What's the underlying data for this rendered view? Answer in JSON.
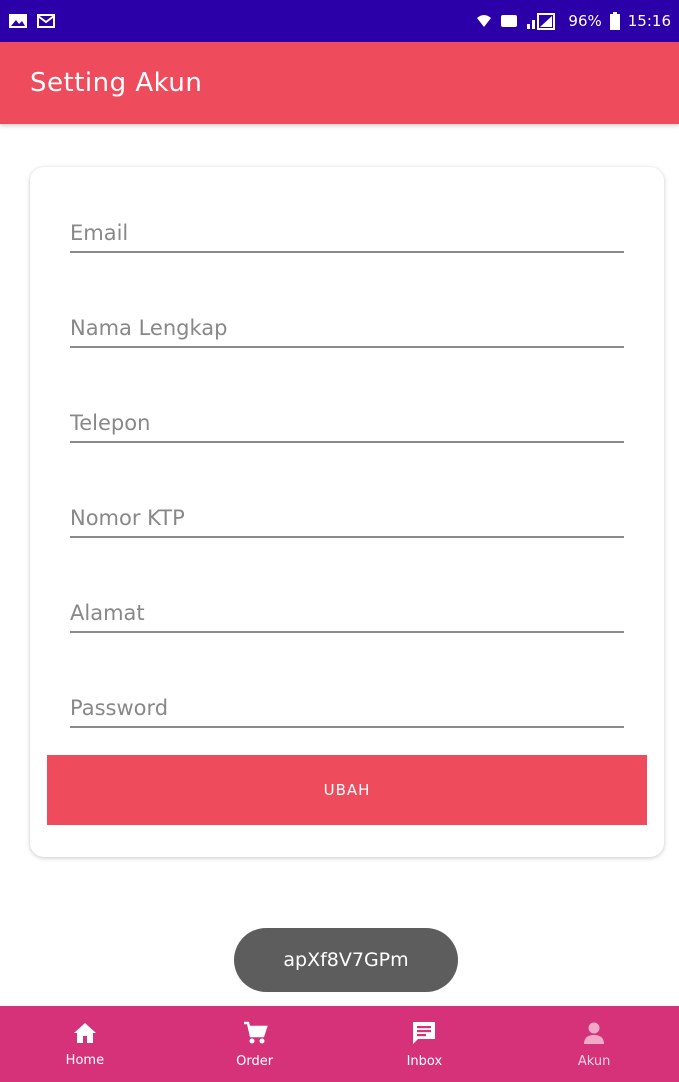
{
  "status_bar": {
    "battery": "96%",
    "time": "15:16"
  },
  "app_bar": {
    "title": "Setting Akun"
  },
  "form": {
    "fields": [
      {
        "placeholder": "Email"
      },
      {
        "placeholder": "Nama Lengkap"
      },
      {
        "placeholder": "Telepon"
      },
      {
        "placeholder": "Nomor KTP"
      },
      {
        "placeholder": "Alamat"
      },
      {
        "placeholder": "Password"
      }
    ],
    "submit_label": "UBAH"
  },
  "toast": {
    "text": "apXf8V7GPm"
  },
  "bottom_nav": {
    "items": [
      {
        "label": "Home",
        "icon": "home-icon"
      },
      {
        "label": "Order",
        "icon": "cart-icon"
      },
      {
        "label": "Inbox",
        "icon": "message-icon"
      },
      {
        "label": "Akun",
        "icon": "account-icon"
      }
    ]
  },
  "colors": {
    "status_bar": "#2b00a8",
    "primary": "#ee4c5c",
    "bottom_nav": "#d63279",
    "toast": "#5d5d5d"
  }
}
